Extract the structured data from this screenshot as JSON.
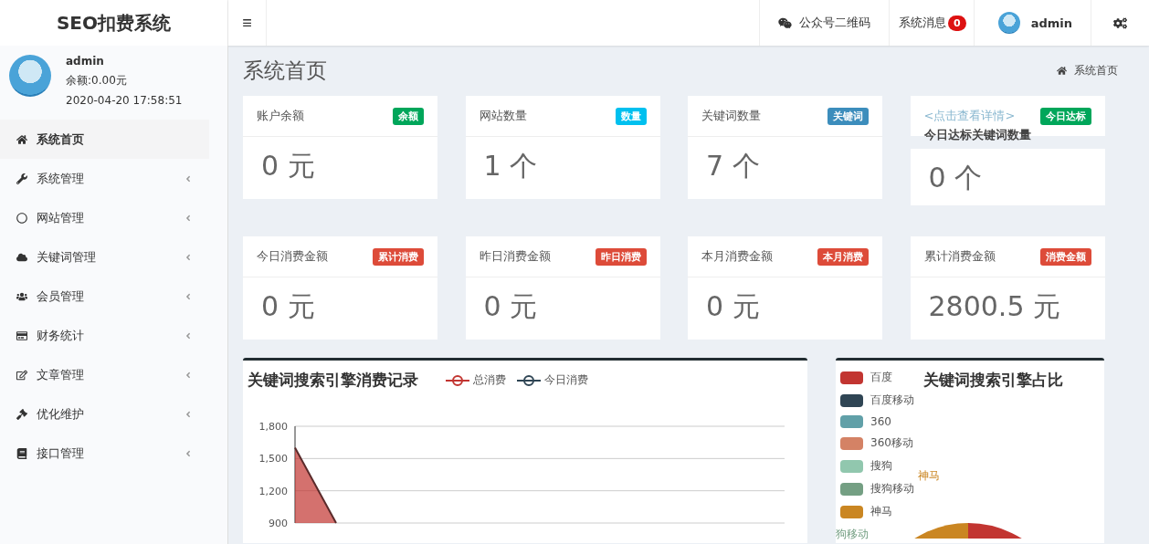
{
  "header": {
    "logo": "SEO扣费系统",
    "toggle": "≡",
    "items": [
      {
        "kind": "wechat",
        "label": "公众号二维码"
      },
      {
        "kind": "messages",
        "label": "系统消息",
        "badge": "0"
      },
      {
        "kind": "user",
        "label": "admin"
      },
      {
        "kind": "settings"
      }
    ]
  },
  "user_panel": {
    "name": "admin",
    "balance": "余额:0.00元",
    "time": "2020-04-20 17:58:51"
  },
  "sidebar": {
    "items": [
      {
        "label": "系统首页",
        "selected": true,
        "expandable": false
      },
      {
        "label": "系统管理",
        "selected": false,
        "expandable": true
      },
      {
        "label": "网站管理",
        "selected": false,
        "expandable": true
      },
      {
        "label": "关键词管理",
        "selected": false,
        "expandable": true
      },
      {
        "label": "会员管理",
        "selected": false,
        "expandable": true
      },
      {
        "label": "财务统计",
        "selected": false,
        "expandable": true
      },
      {
        "label": "文章管理",
        "selected": false,
        "expandable": true
      },
      {
        "label": "优化维护",
        "selected": false,
        "expandable": true
      },
      {
        "label": "接口管理",
        "selected": false,
        "expandable": true
      }
    ]
  },
  "page": {
    "title": "系统首页",
    "breadcrumb": "系统首页"
  },
  "stat_rows": [
    [
      {
        "kind": "plain",
        "title": "账户余额",
        "badge": "余额",
        "color": "#00a65a",
        "value": "0 元"
      },
      {
        "kind": "plain",
        "title": "网站数量",
        "badge": "数量",
        "color": "#00c0ef",
        "value": "1 个"
      },
      {
        "kind": "plain",
        "title": "关键词数量",
        "badge": "关键词",
        "color": "#3c8dbc",
        "value": "7 个"
      },
      {
        "kind": "link",
        "title": "<点击查看详情>",
        "subtitle": "今日达标关键词数量",
        "badge": "今日达标",
        "color": "#00a65a",
        "value": "0 个"
      }
    ],
    [
      {
        "kind": "plain",
        "title": "今日消费金额",
        "badge": "累计消费",
        "color": "#dd4b39",
        "value": "0 元"
      },
      {
        "kind": "plain",
        "title": "昨日消费金额",
        "badge": "昨日消费",
        "color": "#dd4b39",
        "value": "0 元"
      },
      {
        "kind": "plain",
        "title": "本月消费金额",
        "badge": "本月消费",
        "color": "#dd4b39",
        "value": "0 元"
      },
      {
        "kind": "plain",
        "title": "累计消费金额",
        "badge": "消费金额",
        "color": "#dd4b39",
        "value": "2800.5 元"
      }
    ]
  ],
  "line_panel": {
    "title": "关键词搜索引擎消费记录",
    "y_tick_labels": [
      "1,800",
      "1,500",
      "1,200",
      "900"
    ],
    "legend": [
      {
        "name": "总消费",
        "color": "#c23531"
      },
      {
        "name": "今日消费",
        "color": "#2f4554"
      }
    ]
  },
  "pie_panel": {
    "title": "关键词搜索引擎占比",
    "legend": [
      {
        "label": "百度",
        "color": "#c23531"
      },
      {
        "label": "百度移动",
        "color": "#2f4554"
      },
      {
        "label": "360",
        "color": "#61a0a8"
      },
      {
        "label": "360移动",
        "color": "#d48265"
      },
      {
        "label": "搜狗",
        "color": "#91c7ae"
      },
      {
        "label": "搜狗移动",
        "color": "#749f83"
      },
      {
        "label": "神马",
        "color": "#ca8622"
      }
    ],
    "slice_labels": [
      "神马",
      "狗移动"
    ]
  }
}
